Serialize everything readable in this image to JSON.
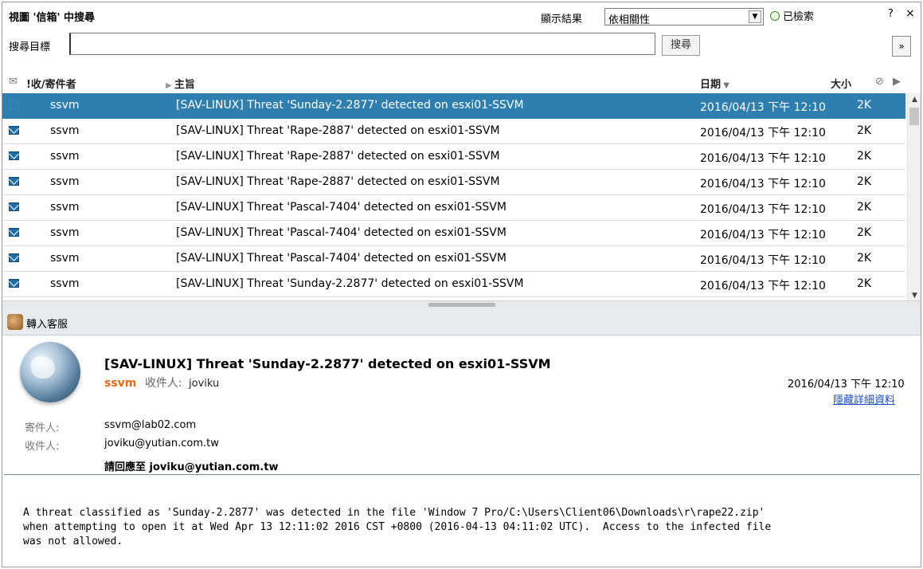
{
  "toolbar": {
    "title": "視圖 '信箱' 中搜尋",
    "show_results_label": "顯示結果",
    "sort_select_value": "依相關性",
    "status_text": "已檢索",
    "help_label": "?",
    "close_label": "×",
    "search_target_label": "搜尋目標",
    "search_input_value": "",
    "search_button_label": "搜尋",
    "expand_label": "»"
  },
  "columns": {
    "envelope": "✉",
    "sender": "!收/寄件者",
    "subject": "主旨",
    "date": "日期",
    "size": "大小",
    "attachment_icon": "paperclip-icon",
    "flag_icon": "flag-icon"
  },
  "messages": [
    {
      "sender": "ssvm",
      "subject": "[SAV-LINUX] Threat 'Sunday-2.2877' detected on esxi01-SSVM",
      "date": "2016/04/13 下午 12:10",
      "size": "2K",
      "selected": true
    },
    {
      "sender": "ssvm",
      "subject": "[SAV-LINUX] Threat 'Rape-2887' detected on esxi01-SSVM",
      "date": "2016/04/13 下午 12:10",
      "size": "2K"
    },
    {
      "sender": "ssvm",
      "subject": "[SAV-LINUX] Threat 'Rape-2887' detected on esxi01-SSVM",
      "date": "2016/04/13 下午 12:10",
      "size": "2K"
    },
    {
      "sender": "ssvm",
      "subject": "[SAV-LINUX] Threat 'Rape-2887' detected on esxi01-SSVM",
      "date": "2016/04/13 下午 12:10",
      "size": "2K"
    },
    {
      "sender": "ssvm",
      "subject": "[SAV-LINUX] Threat 'Pascal-7404' detected on esxi01-SSVM",
      "date": "2016/04/13 下午 12:10",
      "size": "2K"
    },
    {
      "sender": "ssvm",
      "subject": "[SAV-LINUX] Threat 'Pascal-7404' detected on esxi01-SSVM",
      "date": "2016/04/13 下午 12:10",
      "size": "2K"
    },
    {
      "sender": "ssvm",
      "subject": "[SAV-LINUX] Threat 'Pascal-7404' detected on esxi01-SSVM",
      "date": "2016/04/13 下午 12:10",
      "size": "2K"
    },
    {
      "sender": "ssvm",
      "subject": "[SAV-LINUX] Threat 'Sunday-2.2877' detected on esxi01-SSVM",
      "date": "2016/04/13 下午 12:10",
      "size": "2K"
    }
  ],
  "reply_bar": {
    "label": "轉入客服"
  },
  "preview": {
    "subject": "[SAV-LINUX] Threat 'Sunday-2.2877' detected on esxi01-SSVM",
    "sender": "ssvm",
    "to_label": "收件人:",
    "to_name": "joviku",
    "date": "2016/04/13 下午 12:10",
    "hide_details": "隱藏詳細資料",
    "from_label": "寄件人:",
    "from_value": "ssvm@lab02.com",
    "recipient_label": "收件人:",
    "recipient_value": "joviku@yutian.com.tw",
    "reply_to": "請回應至 joviku@yutian.com.tw",
    "body": "A threat classified as 'Sunday-2.2877' was detected in the file 'Window 7 Pro/C:\\Users\\Client06\\Downloads\\r\\rape22.zip'\nwhen attempting to open it at Wed Apr 13 12:11:02 2016 CST +0800 (2016-04-13 04:11:02 UTC).  Access to the infected file\nwas not allowed."
  },
  "colors": {
    "selection": "#2e7fb0",
    "sender_accent": "#e36b18",
    "link": "#1a4dbf"
  }
}
